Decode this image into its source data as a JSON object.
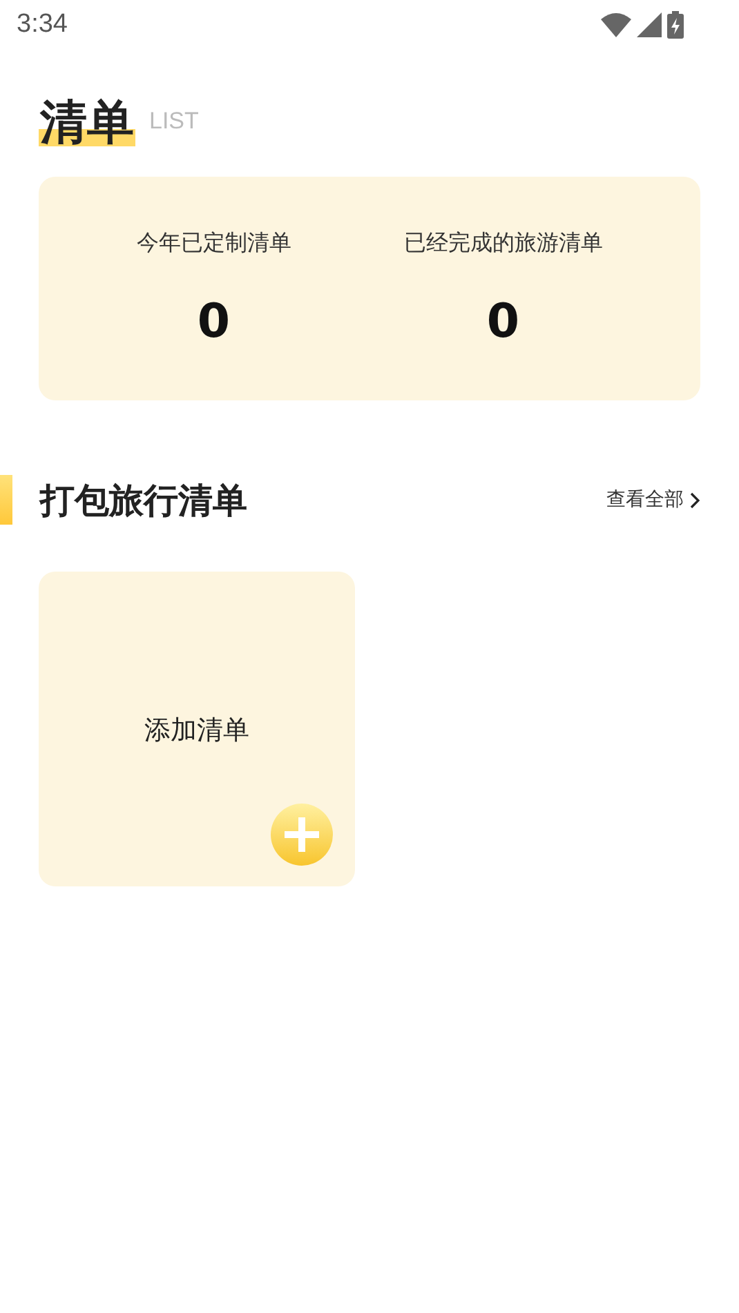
{
  "status_bar": {
    "time": "3:34"
  },
  "header": {
    "title": "清单",
    "subtitle": "LIST"
  },
  "stats": [
    {
      "label": "今年已定制清单",
      "value": "0"
    },
    {
      "label": "已经完成的旅游清单",
      "value": "0"
    }
  ],
  "section": {
    "title": "打包旅行清单",
    "link": "查看全部"
  },
  "add_card": {
    "label": "添加清单"
  }
}
